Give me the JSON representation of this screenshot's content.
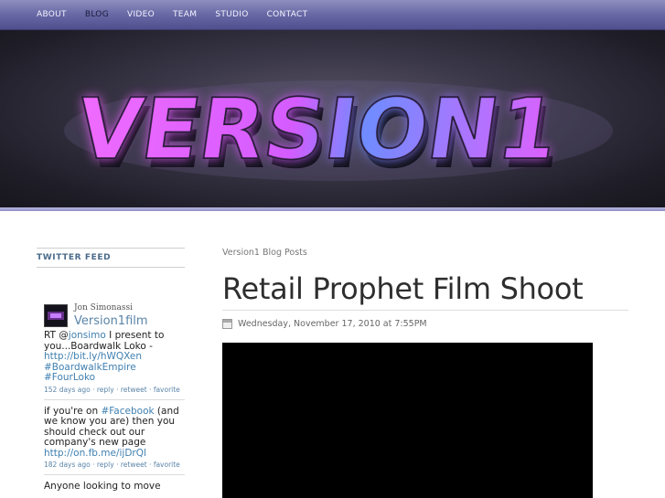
{
  "nav": {
    "items": [
      {
        "label": "ABOUT",
        "active": false
      },
      {
        "label": "BLOG",
        "active": true
      },
      {
        "label": "VIDEO",
        "active": false
      },
      {
        "label": "TEAM",
        "active": false
      },
      {
        "label": "STUDIO",
        "active": false
      },
      {
        "label": "CONTACT",
        "active": false
      }
    ]
  },
  "banner": {
    "logo_text": "VERSION1",
    "colors": {
      "pink": "#e85cff",
      "blue": "#5aa0ff",
      "dark": "#1f1e28"
    }
  },
  "sidebar": {
    "title": "TWITTER FEED",
    "profile": {
      "name": "Jon Simonassi",
      "handle": "Version1film"
    },
    "tweets": [
      {
        "parts": [
          {
            "t": "RT @",
            "link": false
          },
          {
            "t": "jonsimo",
            "link": true
          },
          {
            "t": " I present to you...Boardwalk Loko - ",
            "link": false
          },
          {
            "t": "http://bit.ly/hWQXen",
            "link": true
          },
          {
            "t": " ",
            "link": false
          },
          {
            "t": "#BoardwalkEmpire",
            "link": true
          },
          {
            "t": " ",
            "link": false
          },
          {
            "t": "#FourLoko",
            "link": true
          }
        ],
        "time": "152 days ago"
      },
      {
        "parts": [
          {
            "t": "if you're on ",
            "link": false
          },
          {
            "t": "#Facebook",
            "link": true
          },
          {
            "t": " (and we know you are) then you should check out our company's new page ",
            "link": false
          },
          {
            "t": "http://on.fb.me/ijDrQl",
            "link": true
          }
        ],
        "time": "182 days ago"
      },
      {
        "parts": [
          {
            "t": "Anyone looking to move",
            "link": false
          }
        ],
        "time": ""
      }
    ],
    "actions": {
      "reply": "reply",
      "retweet": "retweet",
      "favorite": "favorite"
    }
  },
  "main": {
    "section_label": "Version1 Blog Posts",
    "post_title": "Retail Prophet Film Shoot",
    "post_date": "Wednesday, November 17, 2010 at 7:55PM"
  }
}
